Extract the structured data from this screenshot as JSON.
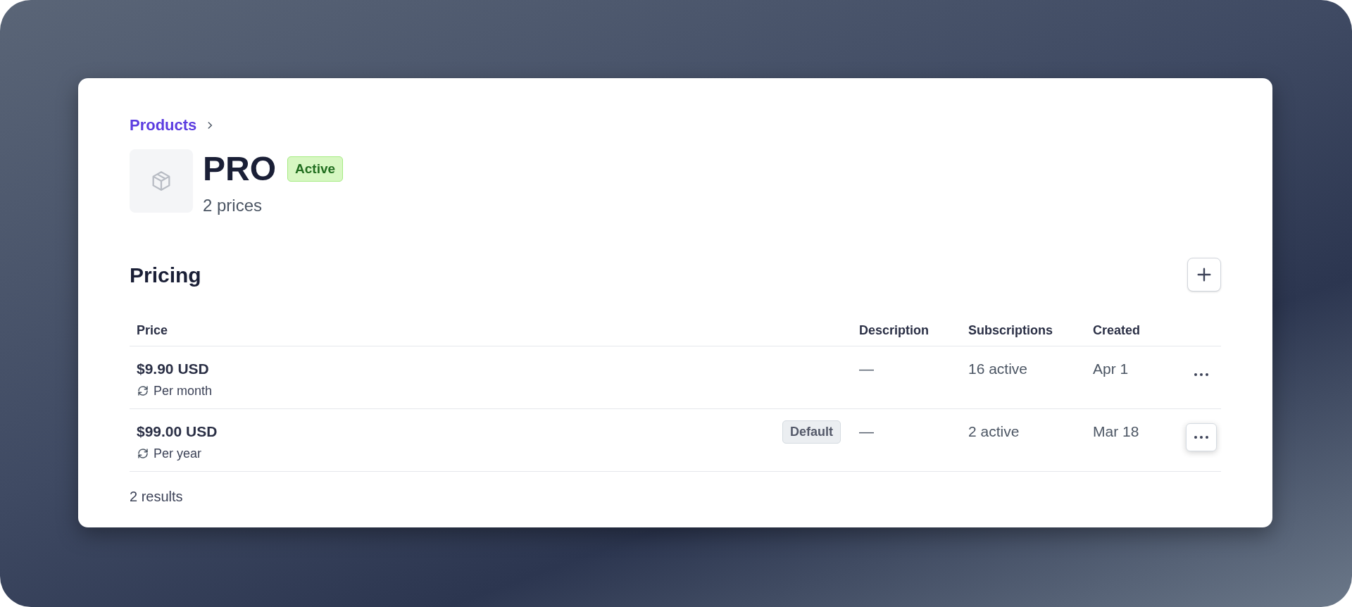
{
  "breadcrumb": [
    {
      "label": "Products"
    }
  ],
  "product": {
    "name": "PRO",
    "status": {
      "label": "Active",
      "kind": "success"
    },
    "subtitle": "2 prices"
  },
  "pricing": {
    "title": "Pricing",
    "table": {
      "columns": [
        "Price",
        "Description",
        "Subscriptions",
        "Created"
      ],
      "rows": [
        {
          "price": "$9.90 USD",
          "interval": "Per month",
          "description": "—",
          "subscriptions": "16 active",
          "created": "Apr 1",
          "actions_focused": false
        },
        {
          "price": "$99.00 USD",
          "interval": "Per year",
          "badge": "Default",
          "description": "—",
          "subscriptions": "2 active",
          "created": "Mar 18",
          "actions_focused": true
        }
      ]
    },
    "results": "2 results"
  }
}
